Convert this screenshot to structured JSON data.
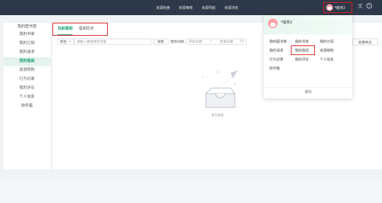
{
  "topnav": [
    "资源检索",
    "资源推荐",
    "资源导航",
    "资源浏览"
  ],
  "user": {
    "name": "*瑶尧2"
  },
  "top_icons": {
    "translate": "translate-icon",
    "help": "help-icon"
  },
  "sidebar": {
    "title": "我的图书馆",
    "items": [
      {
        "label": "我的书单",
        "active": false
      },
      {
        "label": "我的订阅",
        "active": false
      },
      {
        "label": "我的请求",
        "active": false
      },
      {
        "label": "我的借阅",
        "active": true
      },
      {
        "label": "资源荐购",
        "active": false
      },
      {
        "label": "行为记录",
        "active": false
      },
      {
        "label": "我的评论",
        "active": false
      },
      {
        "label": "个人信息",
        "active": false
      },
      {
        "label": "收件箱",
        "active": false
      }
    ]
  },
  "tabs": [
    {
      "label": "当前借阅",
      "active": true
    },
    {
      "label": "借阅历史",
      "active": false
    }
  ],
  "filter": {
    "select": "题名",
    "input_placeholder": "请输入要搜索的内容",
    "search_button": "搜索",
    "date_label": "借阅日期:",
    "start_placeholder": "开始日期",
    "separator": "~",
    "end_placeholder": "结束日期"
  },
  "batch_export": "批量导出",
  "empty_text": "暂无数据",
  "dropdown": {
    "name": "*瑶尧2",
    "items": [
      "我的图书馆",
      "我的书单",
      "我的订阅",
      "我的请求",
      "我的借阅",
      "资源荐购",
      "行为记录",
      "我的评论",
      "个人信息",
      "收件箱"
    ],
    "logout": "退出"
  },
  "colors": {
    "accent": "#17a374",
    "topbar": "#2d3848",
    "highlight": "#e02020"
  }
}
